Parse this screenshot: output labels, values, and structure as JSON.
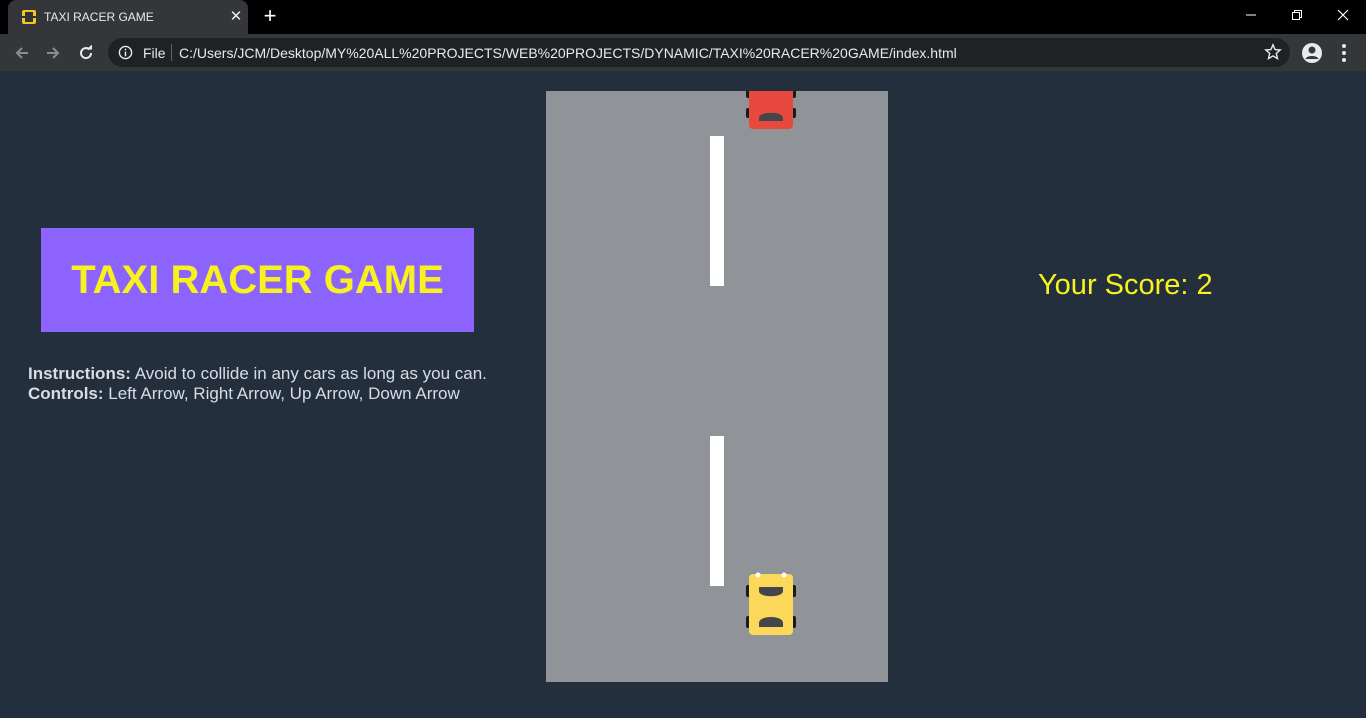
{
  "browser": {
    "tab_title": "TAXI RACER GAME",
    "tab_close_glyph": "✕",
    "new_tab_glyph": "+",
    "address": {
      "scheme_label": "File",
      "url": "C:/Users/JCM/Desktop/MY%20ALL%20PROJECTS/WEB%20PROJECTS/DYNAMIC/TAXI%20RACER%20GAME/index.html"
    },
    "icons": [
      "back-icon",
      "forward-icon",
      "reload-icon",
      "info-icon",
      "star-icon",
      "profile-icon",
      "menu-icon",
      "minimize-icon",
      "restore-icon",
      "close-icon"
    ]
  },
  "game": {
    "title": "TAXI RACER GAME",
    "instructions_label": "Instructions:",
    "instructions_text": " Avoid to collide in any cars as long as you can.",
    "controls_label": "Controls:",
    "controls_text": " Left Arrow, Right Arrow, Up Arrow, Down Arrow",
    "score_label": "Your Score: ",
    "score_value": "2"
  },
  "colors": {
    "page_bg": "#232f3d",
    "title_bg": "#8c63fd",
    "title_text": "#f7f11d",
    "road": "#909499",
    "lane_line": "#ffffff",
    "player_car": "#fcd85a",
    "enemy_car": "#e8493e",
    "score_text": "#f7f11d"
  }
}
